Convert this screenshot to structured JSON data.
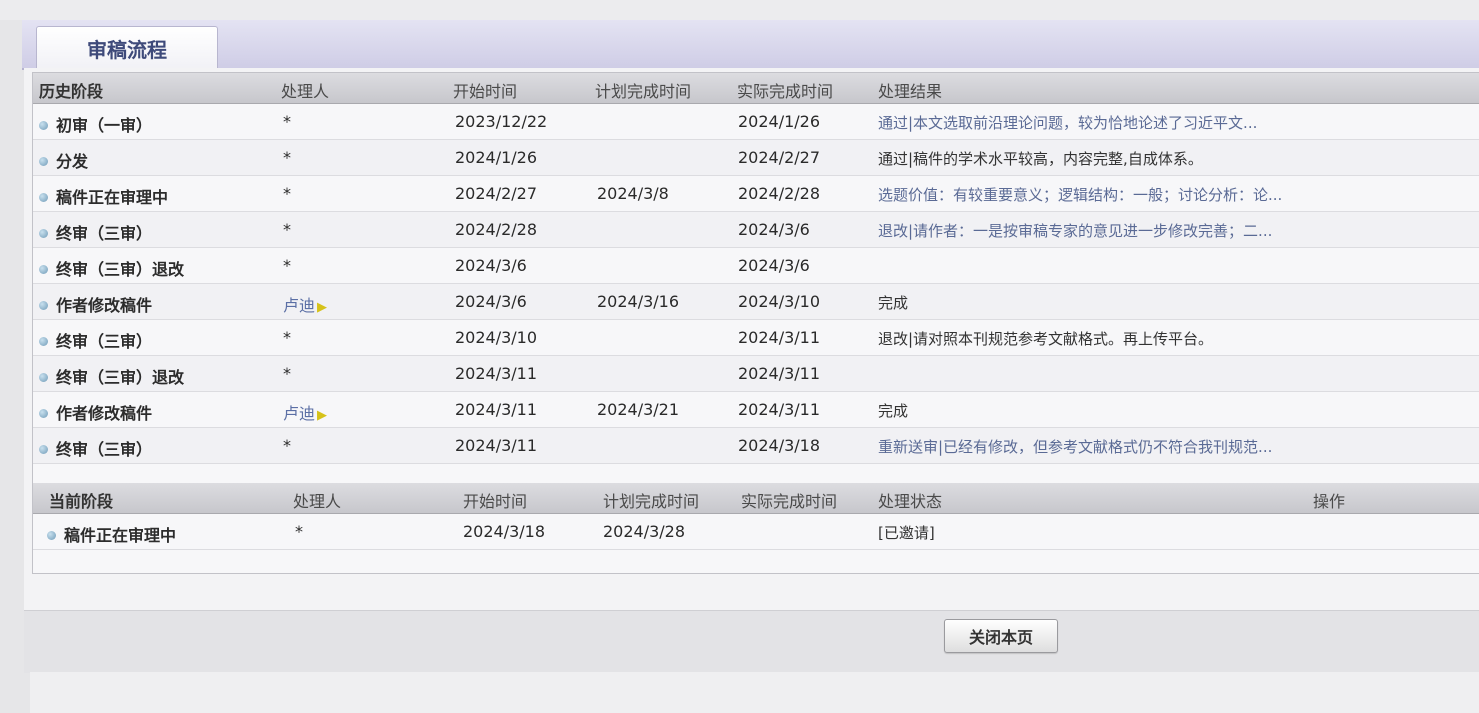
{
  "tab": {
    "title": "审稿流程"
  },
  "history": {
    "headers": [
      "历史阶段",
      "处理人",
      "开始时间",
      "计划完成时间",
      "实际完成时间",
      "处理结果"
    ],
    "rows": [
      {
        "stage": "初审（一审）",
        "handler": "*",
        "start": "2023/12/22",
        "planned": "",
        "actual": "2024/1/26",
        "result": "通过|本文选取前沿理论问题，较为恰地论述了习近平文..."
      },
      {
        "stage": "分发",
        "handler": "*",
        "start": "2024/1/26",
        "planned": "",
        "actual": "2024/2/27",
        "result": "通过|稿件的学术水平较高，内容完整,自成体系。"
      },
      {
        "stage": "稿件正在审理中",
        "handler": "*",
        "start": "2024/2/27",
        "planned": "2024/3/8",
        "actual": "2024/2/28",
        "result": "选题价值：有较重要意义；逻辑结构：一般；讨论分析：论..."
      },
      {
        "stage": "终审（三审）",
        "handler": "*",
        "start": "2024/2/28",
        "planned": "",
        "actual": "2024/3/6",
        "result": "退改|请作者：一是按审稿专家的意见进一步修改完善；二..."
      },
      {
        "stage": "终审（三审）退改",
        "handler": "*",
        "start": "2024/3/6",
        "planned": "",
        "actual": "2024/3/6",
        "result": ""
      },
      {
        "stage": "作者修改稿件",
        "handler": "卢迪",
        "start": "2024/3/6",
        "planned": "2024/3/16",
        "actual": "2024/3/10",
        "result": "完成"
      },
      {
        "stage": "终审（三审）",
        "handler": "*",
        "start": "2024/3/10",
        "planned": "",
        "actual": "2024/3/11",
        "result": "退改|请对照本刊规范参考文献格式。再上传平台。"
      },
      {
        "stage": "终审（三审）退改",
        "handler": "*",
        "start": "2024/3/11",
        "planned": "",
        "actual": "2024/3/11",
        "result": ""
      },
      {
        "stage": "作者修改稿件",
        "handler": "卢迪",
        "start": "2024/3/11",
        "planned": "2024/3/21",
        "actual": "2024/3/11",
        "result": "完成"
      },
      {
        "stage": "终审（三审）",
        "handler": "*",
        "start": "2024/3/11",
        "planned": "",
        "actual": "2024/3/18",
        "result": "重新送审|已经有修改，但参考文献格式仍不符合我刊规范..."
      }
    ]
  },
  "current": {
    "headers": [
      "当前阶段",
      "处理人",
      "开始时间",
      "计划完成时间",
      "实际完成时间",
      "处理状态",
      "操作"
    ],
    "rows": [
      {
        "stage": "稿件正在审理中",
        "handler": "*",
        "start": "2024/3/18",
        "planned": "2024/3/28",
        "actual": "",
        "status": "[已邀请]"
      }
    ]
  },
  "footer": {
    "close_label": "关闭本页"
  }
}
